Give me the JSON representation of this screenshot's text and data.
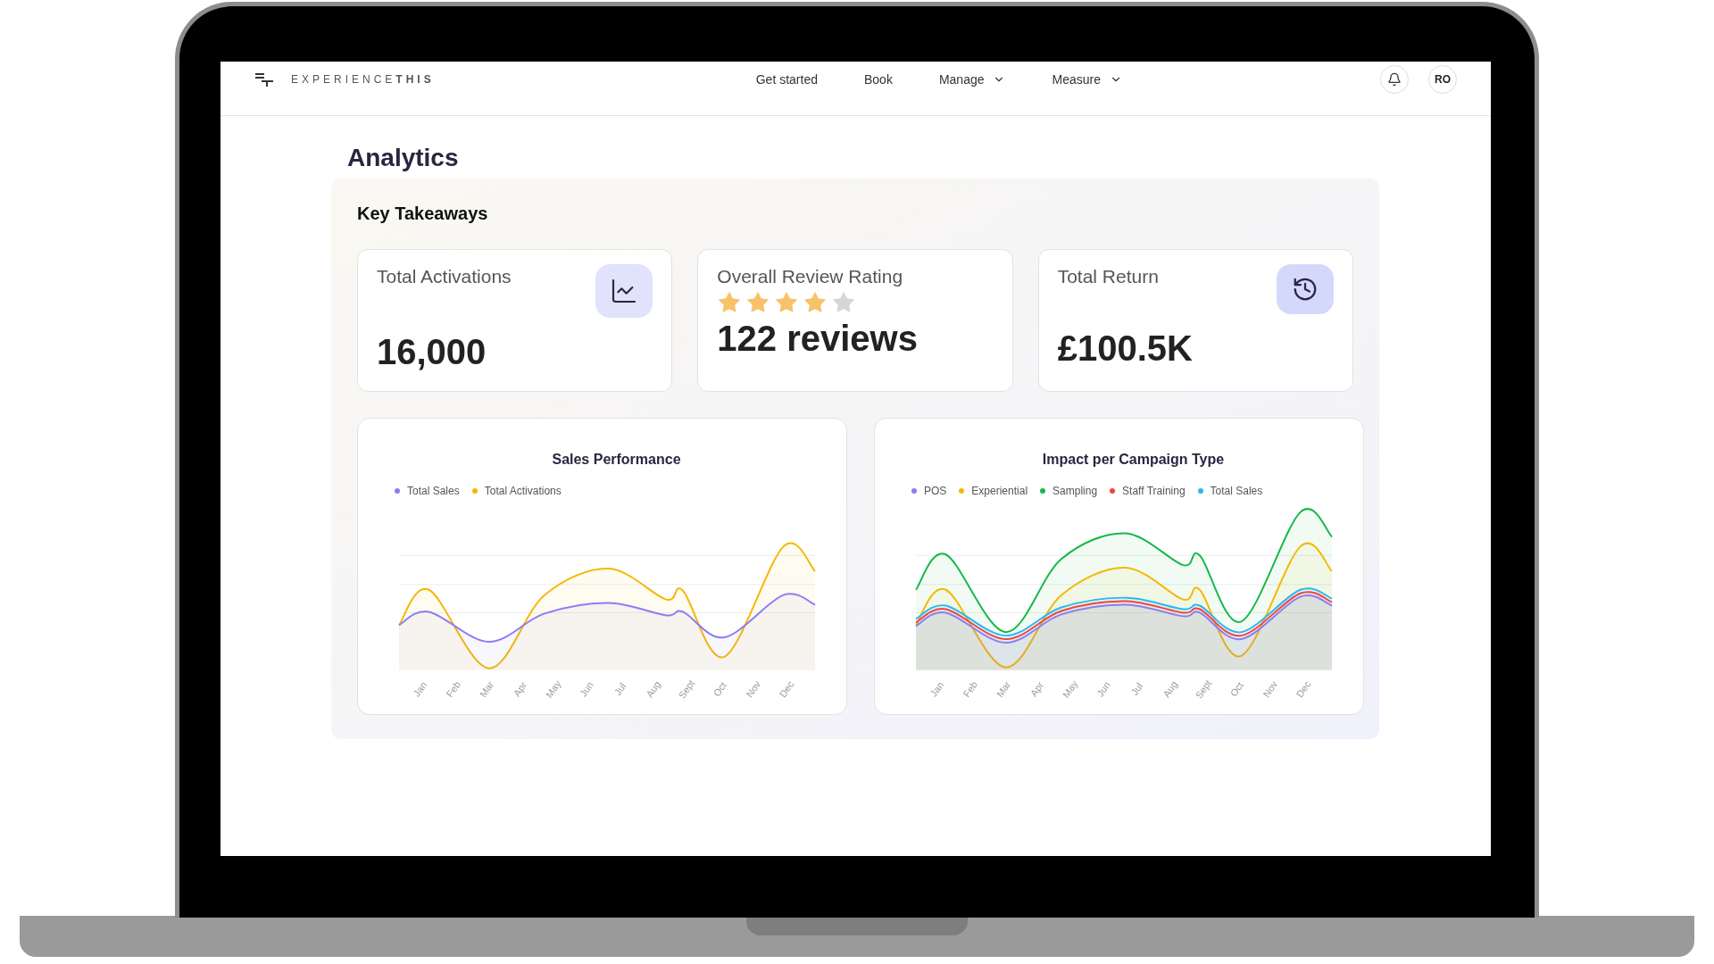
{
  "header": {
    "logo": "EXPERIENCE**THIS**",
    "nav": [
      {
        "label": "Get started",
        "dropdown": false
      },
      {
        "label": "Book",
        "dropdown": false
      },
      {
        "label": "Manage",
        "dropdown": true
      },
      {
        "label": "Measure",
        "dropdown": true
      }
    ],
    "avatar": "RO"
  },
  "page_title": "Analytics",
  "section_title": "Key Takeaways",
  "cards": [
    {
      "kind": "chart",
      "label": "Total Activations",
      "value": "16,000"
    },
    {
      "kind": "rating",
      "label": "Overall Review Rating",
      "value": "122 reviews",
      "stars": 4
    },
    {
      "kind": "history",
      "label": "Total Return",
      "value": "£100.5K"
    }
  ],
  "charts": [
    {
      "title": "Sales Performance",
      "legend": [
        {
          "name": "Total Sales",
          "color": "#8b7cf6"
        },
        {
          "name": "Total Activations",
          "color": "#f5b800"
        }
      ],
      "months": [
        "Jan",
        "Feb",
        "Mar",
        "Apr",
        "May",
        "Jun",
        "Jul",
        "Aug",
        "Sept",
        "Oct",
        "Nov",
        "Dec"
      ]
    },
    {
      "title": "Impact per Campaign Type",
      "legend": [
        {
          "name": "POS",
          "color": "#8b7cf6"
        },
        {
          "name": "Experiential",
          "color": "#f5b800"
        },
        {
          "name": "Sampling",
          "color": "#16b84a"
        },
        {
          "name": "Staff Training",
          "color": "#ef4444"
        },
        {
          "name": "Total Sales",
          "color": "#29b6f6"
        }
      ],
      "months": [
        "Jan",
        "Feb",
        "Mar",
        "Apr",
        "May",
        "Jun",
        "Jul",
        "Aug",
        "Sept",
        "Oct",
        "Nov",
        "Dec"
      ]
    }
  ]
}
